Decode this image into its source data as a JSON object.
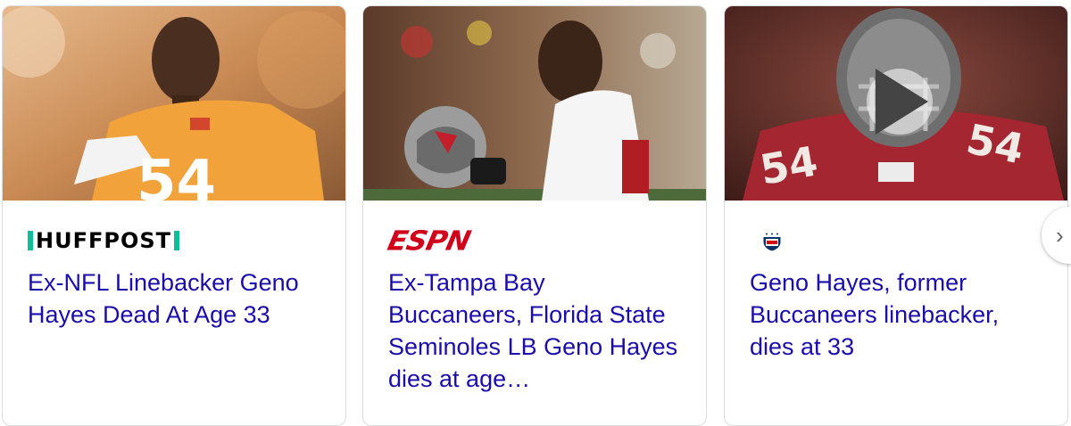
{
  "cards": [
    {
      "source_name": "HUFFPOST",
      "source_icon": "huffpost-logo",
      "headline": "Ex-NFL Linebacker Geno Hayes Dead At Age 33",
      "jersey_number": "54",
      "jersey_color": "#f2a23a"
    },
    {
      "source_name": "ESPN",
      "source_icon": "espn-logo",
      "headline": "Ex-Tampa Bay Buccaneers, Florida State Seminoles LB Geno Hayes dies at age…",
      "jersey_color": "#ffffff"
    },
    {
      "source_name": "NFL",
      "source_icon": "nfl-shield-logo",
      "headline": "Geno Hayes, former Buccaneers linebacker, dies at 33",
      "jersey_number": "54",
      "jersey_color": "#a32630",
      "has_video": true
    }
  ],
  "next_button": {
    "icon": "chevron-right-icon",
    "glyph": "›"
  },
  "colors": {
    "headline_link": "#1a0dab",
    "huffpost_green": "#0dbe98",
    "espn_red": "#d0021b",
    "card_border": "#dadce0"
  }
}
